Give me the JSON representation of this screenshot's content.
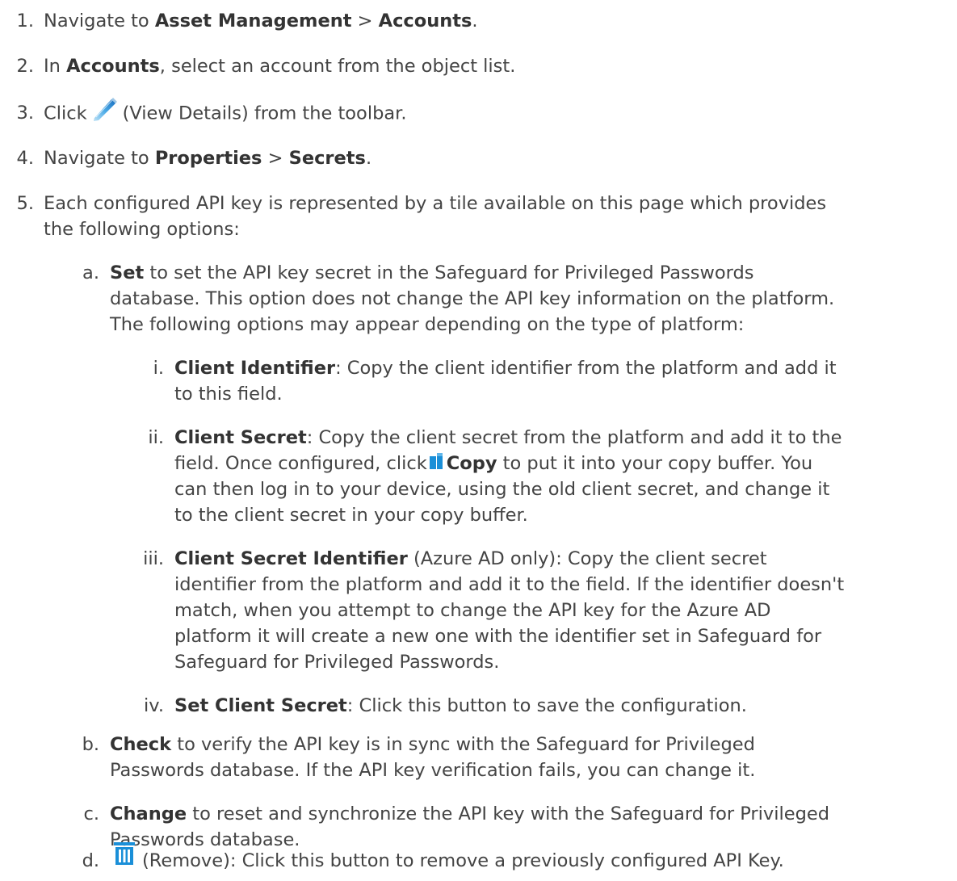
{
  "steps": [
    {
      "num": "1.",
      "prefix": "Navigate to ",
      "b1": "Asset Management",
      "sep": " > ",
      "b2": "Accounts",
      "suffix": "."
    },
    {
      "num": "2.",
      "prefix": "In ",
      "b1": "Accounts",
      "suffix": ", select an account from the object list."
    },
    {
      "num": "3.",
      "prefix": "Click",
      "icon": "pencil-icon",
      "suffix": "(View Details) from the toolbar."
    },
    {
      "num": "4.",
      "prefix": "Navigate to ",
      "b1": "Properties",
      "sep": " > ",
      "b2": "Secrets",
      "suffix": "."
    },
    {
      "num": "5.",
      "lines": [
        "Each configured API key is represented by a tile available on this page which provides",
        "the following options:"
      ]
    }
  ],
  "options": {
    "a": {
      "num": "a.",
      "bold": "Set",
      "line1": " to set the API key secret in the Safeguard for Privileged Passwords",
      "lines": [
        "database. This option does not change the API key information on the platform.",
        "The following options may appear depending on the type of platform:"
      ],
      "subitems": {
        "i": {
          "num": "i.",
          "bold": "Client Identifier",
          "line1": ": Copy the client identifier from the platform and add it",
          "lines": [
            "to this field."
          ]
        },
        "ii": {
          "num": "ii.",
          "bold": "Client Secret",
          "line1": ": Copy the client secret from the platform and add it to the",
          "line2_prefix": "field. Once configured, click",
          "line2_icon": "copy-icon",
          "line2_bold": "Copy",
          "line2_suffix": " to put it into your copy buffer. You",
          "lines": [
            "can then log in to your device, using the old client secret, and change it",
            "to the client secret in your copy buffer."
          ]
        },
        "iii": {
          "num": "iii.",
          "bold": "Client Secret Identifier",
          "line1": " (Azure AD only): Copy the client secret",
          "lines": [
            "identifier from the platform and add it to the field. If the identifier doesn't",
            "match, when you attempt to change the API key for the Azure AD",
            "platform it will create a new one with the identifier set in Safeguard for",
            "Safeguard for Privileged Passwords."
          ]
        },
        "iv": {
          "num": "iv.",
          "bold": "Set Client Secret",
          "line1": ": Click this button to save the configuration."
        }
      }
    },
    "b": {
      "num": "b.",
      "bold": "Check",
      "line1": " to verify the API key is in sync with the Safeguard for Privileged",
      "lines": [
        "Passwords database. If the API key verification fails, you can change it."
      ]
    },
    "c": {
      "num": "c.",
      "bold": "Change",
      "line1": " to reset and synchronize the API key with the Safeguard for Privileged",
      "lines": [
        "Passwords database."
      ]
    },
    "d": {
      "num": "d.",
      "icon": "trash-icon",
      "line1": "(Remove): Click this button to remove a previously configured API Key."
    }
  },
  "colors": {
    "text": "#444444",
    "bold": "#333333",
    "icon_blue": "#1a8fd8"
  }
}
